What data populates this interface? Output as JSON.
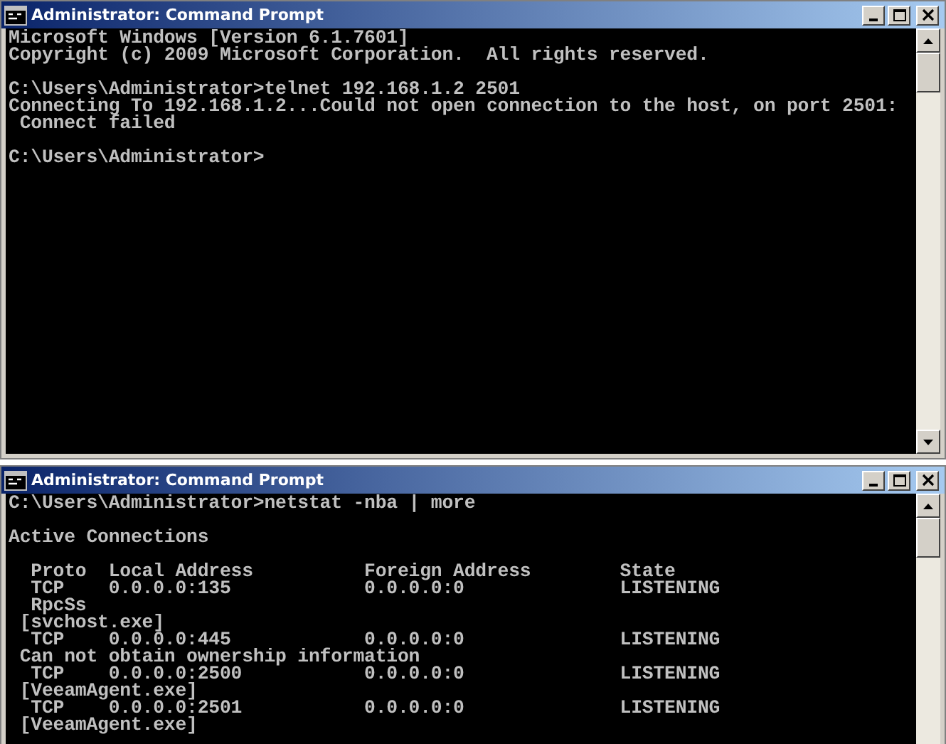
{
  "windows": [
    {
      "title": "Administrator: Command Prompt",
      "blocks": [
        [
          "Microsoft Windows [Version 6.1.7601]",
          "Copyright (c) 2009 Microsoft Corporation.  All rights reserved."
        ],
        [
          "C:\\Users\\Administrator>telnet 192.168.1.2 2501",
          "Connecting To 192.168.1.2...Could not open connection to the host, on port 2501:",
          " Connect failed"
        ],
        [
          "C:\\Users\\Administrator>"
        ]
      ]
    },
    {
      "title": "Administrator: Command Prompt",
      "blocks": [
        [
          "C:\\Users\\Administrator>netstat -nba | more"
        ],
        [
          "Active Connections"
        ],
        [
          "  Proto  Local Address          Foreign Address        State",
          "  TCP    0.0.0.0:135            0.0.0.0:0              LISTENING",
          "  RpcSs",
          " [svchost.exe]",
          "  TCP    0.0.0.0:445            0.0.0.0:0              LISTENING",
          " Can not obtain ownership information",
          "  TCP    0.0.0.0:2500           0.0.0.0:0              LISTENING",
          " [VeeamAgent.exe]",
          "  TCP    0.0.0.0:2501           0.0.0.0:0              LISTENING",
          " [VeeamAgent.exe]"
        ]
      ]
    }
  ]
}
